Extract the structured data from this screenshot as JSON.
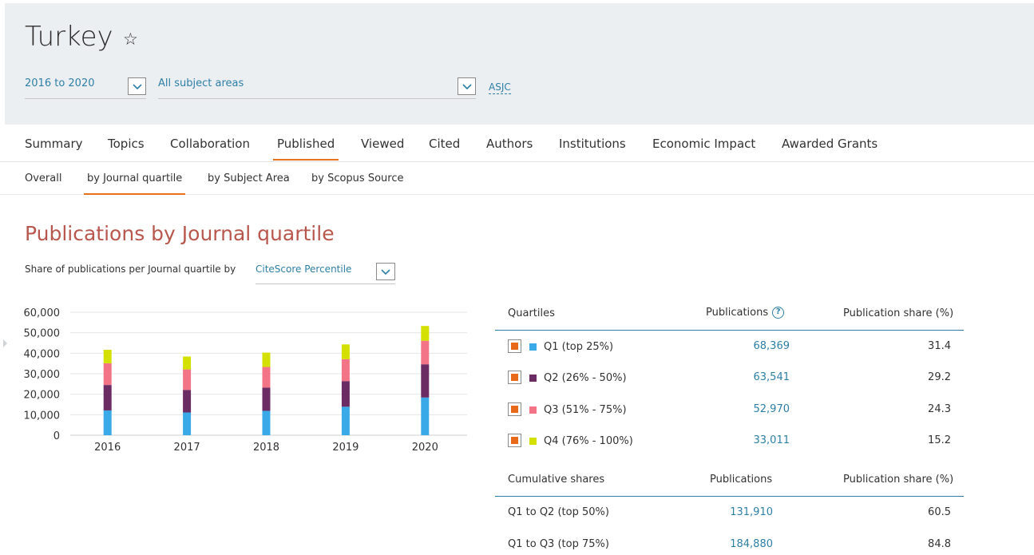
{
  "header": {
    "country": "Turkey",
    "year_range": "2016 to 2020",
    "subject_area": "All subject areas",
    "asjc_link": "ASJC"
  },
  "tabs": [
    {
      "label": "Summary"
    },
    {
      "label": "Topics"
    },
    {
      "label": "Collaboration"
    },
    {
      "label": "Published",
      "active": true
    },
    {
      "label": "Viewed"
    },
    {
      "label": "Cited"
    },
    {
      "label": "Authors"
    },
    {
      "label": "Institutions"
    },
    {
      "label": "Economic Impact"
    },
    {
      "label": "Awarded Grants"
    }
  ],
  "subtabs": [
    {
      "label": "Overall"
    },
    {
      "label": "by Journal quartile",
      "active": true
    },
    {
      "label": "by Subject Area"
    },
    {
      "label": "by Scopus Source"
    }
  ],
  "section": {
    "title": "Publications by Journal quartile",
    "share_prefix": "Share of publications per Journal quartile by",
    "metric": "CiteScore Percentile"
  },
  "chart_data": {
    "type": "bar",
    "stacked": true,
    "categories": [
      "2016",
      "2017",
      "2018",
      "2019",
      "2020"
    ],
    "series": [
      {
        "name": "Q1 (top 25%)",
        "color": "#3aa9e8",
        "values": [
          12100,
          11100,
          11900,
          13900,
          18400
        ]
      },
      {
        "name": "Q2 (26% - 50%)",
        "color": "#6b2b63",
        "values": [
          12400,
          11000,
          11300,
          12500,
          16200
        ]
      },
      {
        "name": "Q3 (51% - 75%)",
        "color": "#f47487",
        "values": [
          10600,
          10000,
          10100,
          10700,
          11500
        ]
      },
      {
        "name": "Q4 (76% - 100%)",
        "color": "#d4e000",
        "values": [
          6600,
          6300,
          7000,
          7200,
          7200
        ]
      }
    ],
    "yticks": [
      "60,000",
      "50,000",
      "40,000",
      "30,000",
      "20,000",
      "10,000",
      "0"
    ],
    "ylim": [
      0,
      60000
    ],
    "grid": true
  },
  "quartile_table": {
    "headers": {
      "quartiles": "Quartiles",
      "publications": "Publications",
      "share": "Publication share (%)"
    },
    "rows": [
      {
        "label": "Q1 (top 25%)",
        "publications": "68,369",
        "share": "31.4",
        "color": "#3aa9e8"
      },
      {
        "label": "Q2 (26% - 50%)",
        "publications": "63,541",
        "share": "29.2",
        "color": "#6b2b63"
      },
      {
        "label": "Q3 (51% - 75%)",
        "publications": "52,970",
        "share": "24.3",
        "color": "#f47487"
      },
      {
        "label": "Q4 (76% - 100%)",
        "publications": "33,011",
        "share": "15.2",
        "color": "#d4e000"
      }
    ]
  },
  "cumulative_table": {
    "headers": {
      "label": "Cumulative shares",
      "publications": "Publications",
      "share": "Publication share (%)"
    },
    "rows": [
      {
        "label": "Q1 to Q2 (top 50%)",
        "publications": "131,910",
        "share": "60.5"
      },
      {
        "label": "Q1 to Q3 (top 75%)",
        "publications": "184,880",
        "share": "84.8"
      }
    ]
  },
  "icons": {
    "star": "star-outline-icon",
    "help": "help-circle-icon",
    "chevron": "chevron-down-icon"
  }
}
